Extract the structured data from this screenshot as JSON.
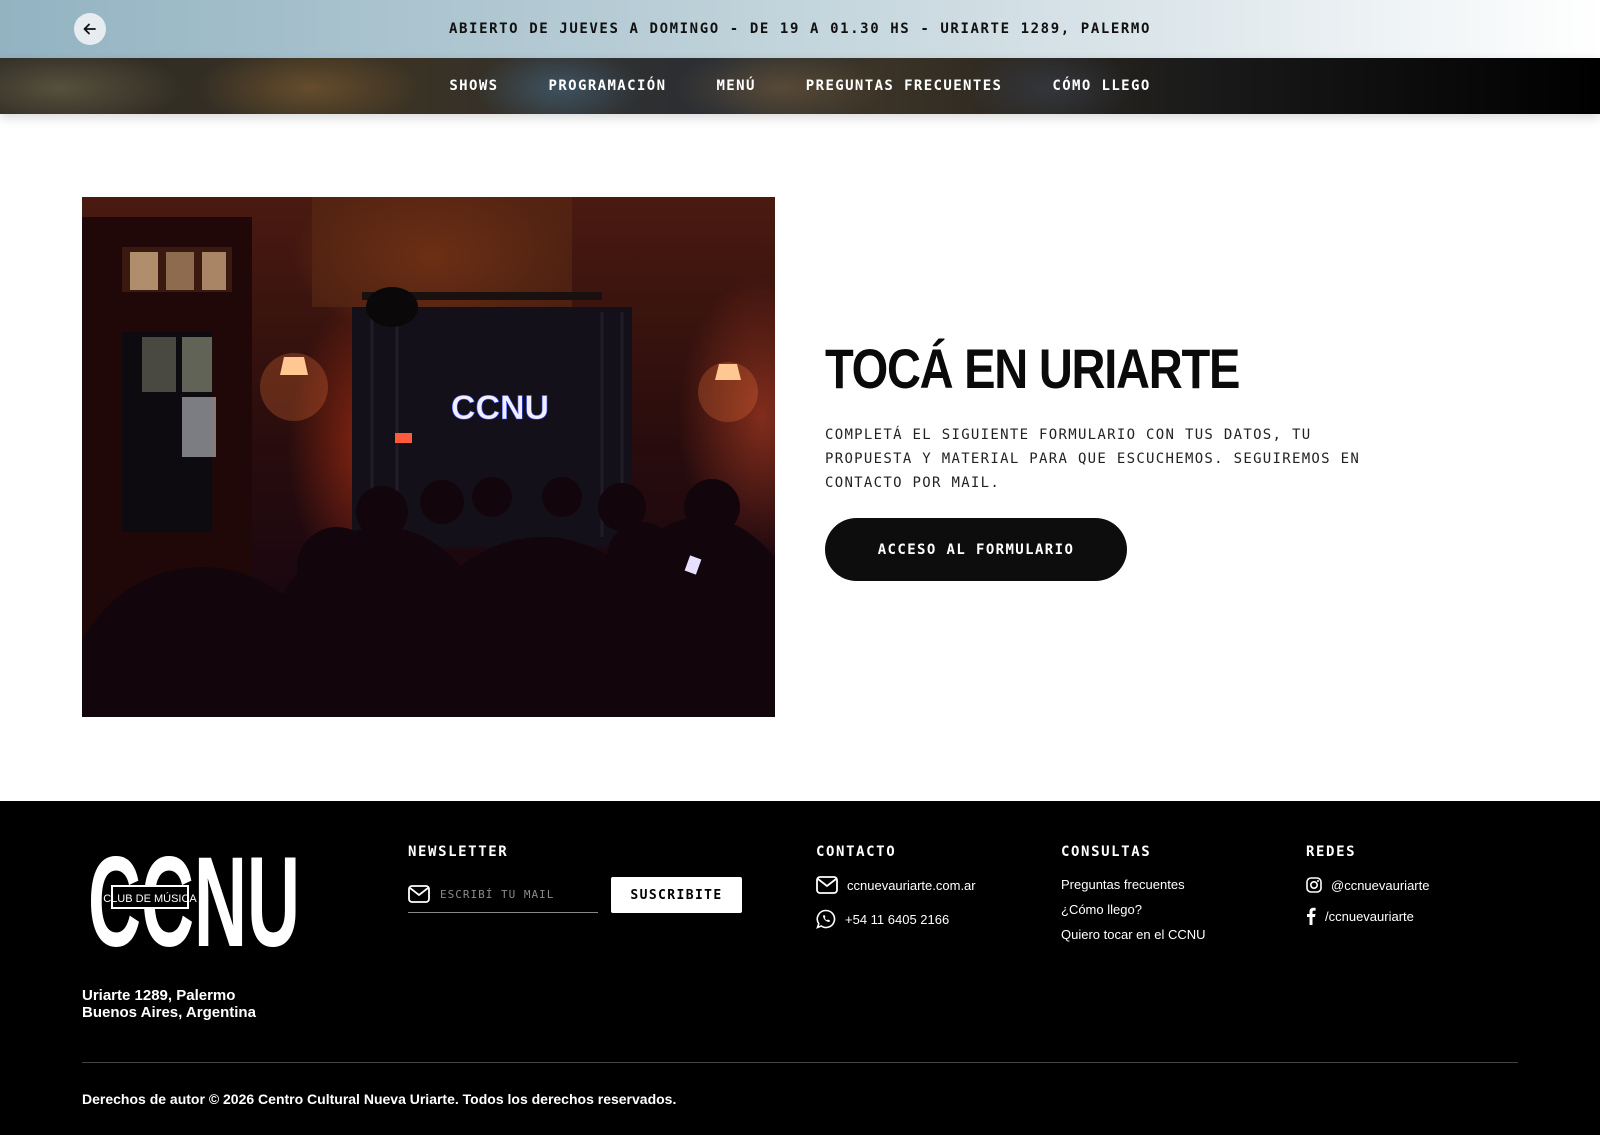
{
  "topbar": {
    "announcement": "ABIERTO DE JUEVES A DOMINGO - DE 19 A 01.30 HS - URIARTE 1289, PALERMO",
    "back_icon": "arrow-left-icon"
  },
  "nav": {
    "items": [
      {
        "label": "SHOWS"
      },
      {
        "label": "PROGRAMACIÓN"
      },
      {
        "label": "MENÚ"
      },
      {
        "label": "PREGUNTAS FRECUENTES"
      },
      {
        "label": "CÓMO LLEGO"
      }
    ]
  },
  "hero": {
    "image_sign": "CCNU",
    "title": "TOCÁ EN URIARTE",
    "description": "COMPLETÁ EL SIGUIENTE FORMULARIO CON TUS DATOS, TU PROPUESTA Y MATERIAL PARA QUE ESCUCHEMOS. SEGUIREMOS EN CONTACTO POR MAIL.",
    "cta_label": "ACCESO AL FORMULARIO"
  },
  "footer": {
    "logo_text": "CCNU",
    "logo_badge": "CLUB DE MÚSICA",
    "address_line1": "Uriarte 1289, Palermo",
    "address_line2": "Buenos Aires, Argentina",
    "newsletter": {
      "title": "NEWSLETTER",
      "placeholder": "ESCRIBÍ TU MAIL",
      "button_label": "SUSCRIBITE",
      "icon": "mail-icon"
    },
    "contacto": {
      "title": "CONTACTO",
      "email": "ccnuevauriarte.com.ar",
      "phone": "+54 11 6405 2166"
    },
    "consultas": {
      "title": "CONSULTAS",
      "links": [
        "Preguntas frecuentes",
        "¿Cómo llego?",
        "Quiero tocar en el CCNU"
      ]
    },
    "redes": {
      "title": "REDES",
      "instagram": "@ccnuevauriarte",
      "facebook": "/ccnuevauriarte"
    },
    "copyright": "Derechos de autor © 2026 Centro Cultural Nueva Uriarte. Todos los derechos reservados."
  },
  "colors": {
    "footer_bg": "#000000",
    "cta_bg": "#0d0d0d",
    "topbar_gradient_start": "#93b3c2"
  }
}
